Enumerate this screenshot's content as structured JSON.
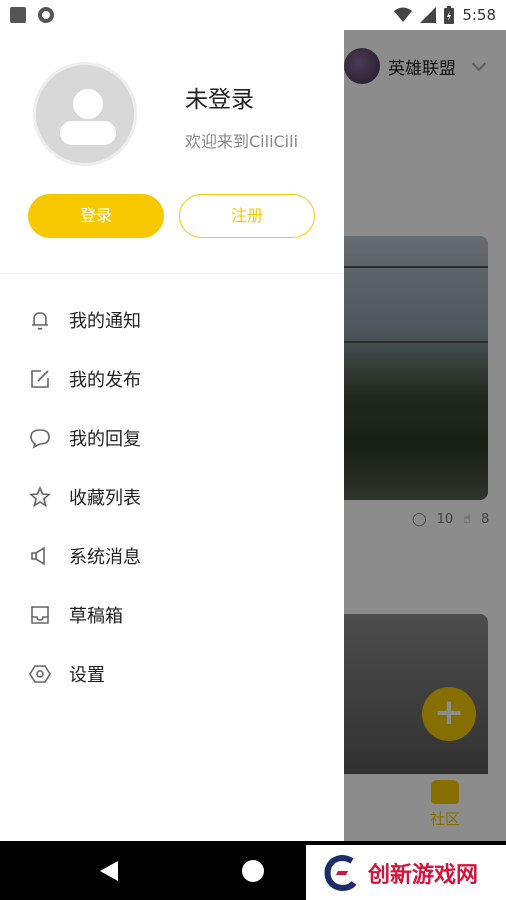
{
  "status_bar": {
    "time": "5:58"
  },
  "background": {
    "game_name": "英雄联盟",
    "comments": "10",
    "likes": "8",
    "tab_label": "社区",
    "fab_label": "+"
  },
  "drawer": {
    "user_name": "未登录",
    "welcome": "欢迎来到CiliCili",
    "login_label": "登录",
    "register_label": "注册",
    "menu": [
      {
        "label": "我的通知",
        "icon": "bell-icon"
      },
      {
        "label": "我的发布",
        "icon": "edit-icon"
      },
      {
        "label": "我的回复",
        "icon": "comment-icon"
      },
      {
        "label": "收藏列表",
        "icon": "star-icon"
      },
      {
        "label": "系统消息",
        "icon": "speaker-icon"
      },
      {
        "label": "草稿箱",
        "icon": "inbox-icon"
      },
      {
        "label": "设置",
        "icon": "settings-icon"
      }
    ]
  },
  "watermark": {
    "text": "创新游戏网"
  },
  "colors": {
    "accent": "#f5c800",
    "watermark": "#d4143c"
  }
}
